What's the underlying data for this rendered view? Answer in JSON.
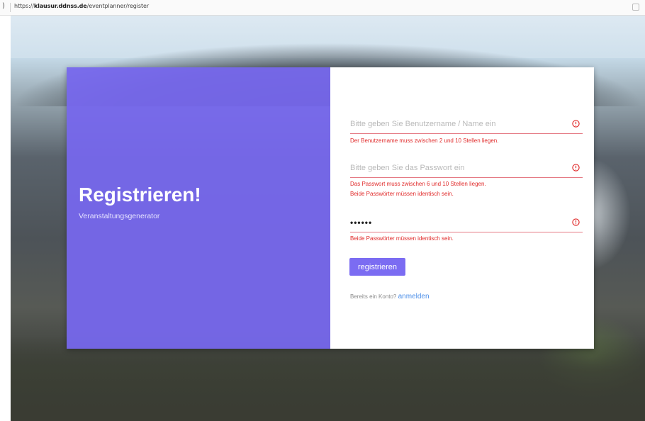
{
  "browser": {
    "url_prefix": "https://",
    "url_host": "klausur.ddnss.de",
    "url_path": "/eventplanner/register",
    "back_icon": "back-icon",
    "extension_icon": "extension-icon"
  },
  "panel": {
    "title": "Registrieren!",
    "subtitle": "Veranstaltungsgenerator",
    "accent_color": "#7667ec"
  },
  "form": {
    "username": {
      "placeholder": "Bitte geben Sie Benutzername / Name ein",
      "value": "",
      "errors": [
        "Der Benutzername muss zwischen 2 und 10 Stellen liegen."
      ]
    },
    "password": {
      "placeholder": "Bitte geben Sie das Passwort ein",
      "value": "",
      "errors": [
        "Das Passwort muss zwischen 6 und 10 Stellen liegen.",
        "Beide Passwörter müssen identisch sein."
      ]
    },
    "password_repeat": {
      "placeholder": "",
      "value": "••••••",
      "errors": [
        "Beide Passwörter müssen identisch sein."
      ]
    },
    "submit_label": "registrieren",
    "login_prompt": "Bereits ein Konto?",
    "login_link": "anmelden",
    "error_color": "#e02a2a",
    "error_icon": "alert-circle-icon"
  }
}
